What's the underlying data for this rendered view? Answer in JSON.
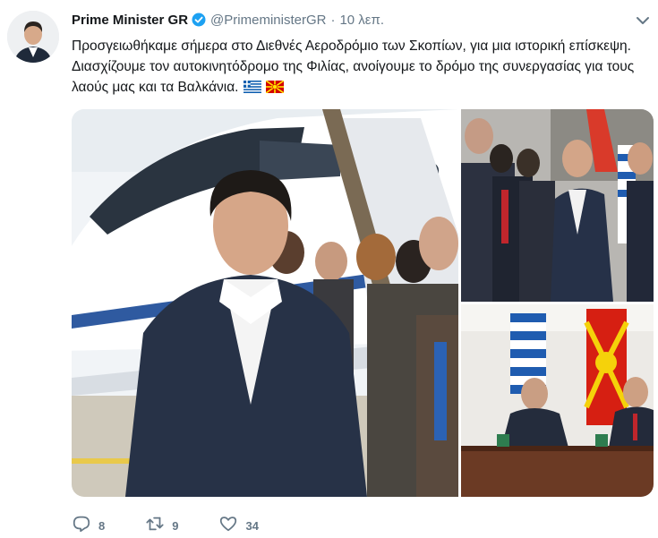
{
  "tweet": {
    "author_name": "Prime Minister GR",
    "handle": "@PrimeministerGR",
    "separator": "·",
    "time": "10 λεπ.",
    "text": "Προσγειωθήκαμε σήμερα στο Διεθνές Αεροδρόμιο των Σκοπίων, για μια ιστορική επίσκεψη. Διασχίζουμε τον αυτοκινητόδρομο της Φιλίας, ανοίγουμε το δρόμο της συνεργασίας για τους λαούς μας και τα Βαλκάνια.",
    "flags": [
      "greece-flag",
      "north-macedonia-flag"
    ]
  },
  "actions": {
    "replies": "8",
    "retweets": "9",
    "likes": "34"
  },
  "colors": {
    "text": "#14171a",
    "muted": "#657786",
    "verified": "#1da1f2"
  }
}
